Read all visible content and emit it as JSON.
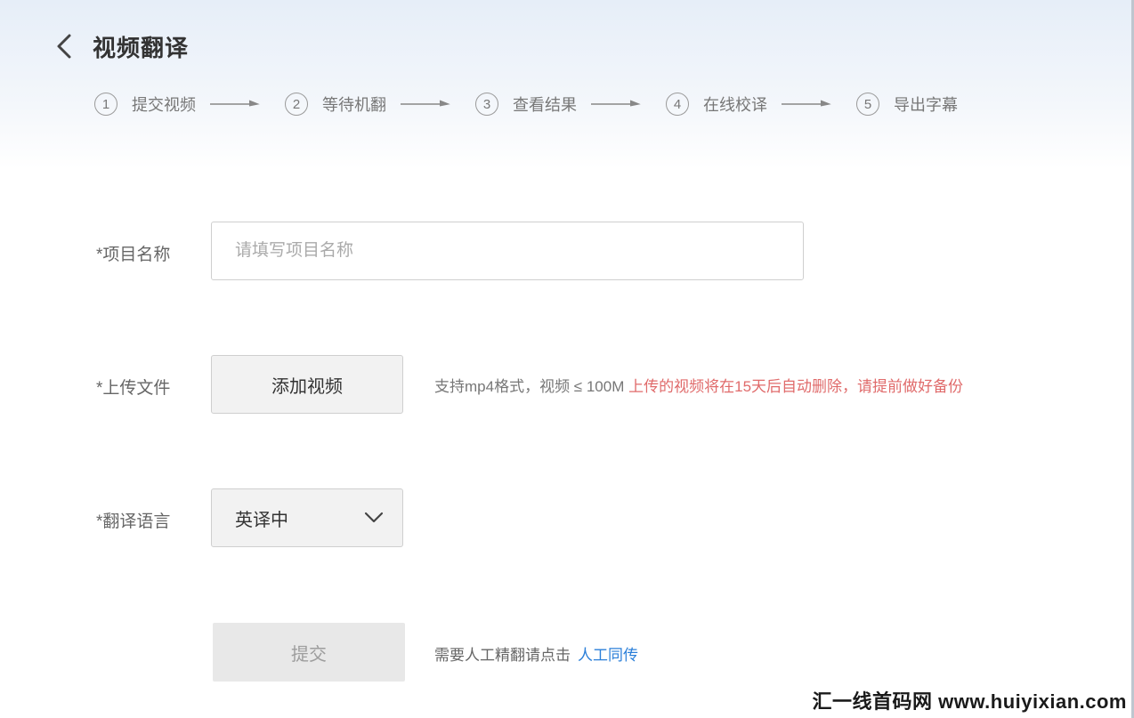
{
  "header": {
    "title": "视频翻译",
    "back_icon": "chevron-left-icon"
  },
  "steps": [
    {
      "num": "1",
      "label": "提交视频"
    },
    {
      "num": "2",
      "label": "等待机翻"
    },
    {
      "num": "3",
      "label": "查看结果"
    },
    {
      "num": "4",
      "label": "在线校译"
    },
    {
      "num": "5",
      "label": "导出字幕"
    }
  ],
  "form": {
    "project_name": {
      "label": "*项目名称",
      "placeholder": "请填写项目名称",
      "value": ""
    },
    "upload": {
      "label": "*上传文件",
      "button_label": "添加视频",
      "hint_normal": "支持mp4格式，视频 ≤ 100M ",
      "hint_warning": "上传的视频将在15天后自动删除，请提前做好备份"
    },
    "language": {
      "label": "*翻译语言",
      "selected": "英译中"
    },
    "submit": {
      "button_label": "提交",
      "hint_text": "需要人工精翻请点击",
      "link_label": "人工同传"
    }
  },
  "watermark": "汇一线首码网 www.huiyixian.com",
  "colors": {
    "warning": "#e06b6b",
    "link": "#2b7fd9",
    "header_gradient": "#e6eef8"
  }
}
